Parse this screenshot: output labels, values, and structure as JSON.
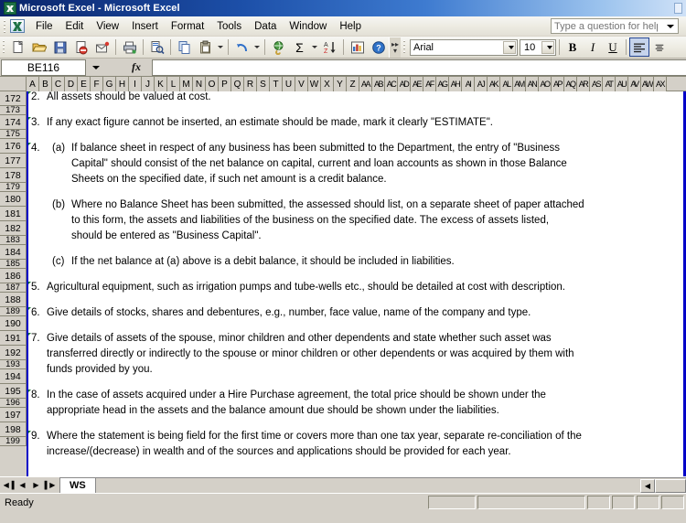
{
  "window": {
    "title": "Microsoft Excel - Microsoft Excel",
    "app_icon": "excel-icon"
  },
  "menubar": {
    "items": [
      "File",
      "Edit",
      "View",
      "Insert",
      "Format",
      "Tools",
      "Data",
      "Window",
      "Help"
    ],
    "ask_a_question": {
      "value": "",
      "placeholder": "Type a question for help"
    }
  },
  "toolbar": {
    "buttons": [
      {
        "name": "new-document-button",
        "glyph": "❐",
        "title": "New"
      },
      {
        "name": "open-folder-button",
        "glyph": "📂",
        "title": "Open"
      },
      {
        "name": "save-button",
        "glyph": "💾",
        "title": "Save"
      },
      {
        "name": "permission-button",
        "glyph": "⛔",
        "title": "Permission"
      },
      {
        "name": "email-button",
        "glyph": "✉",
        "title": "E-mail"
      },
      {
        "name": "print-button",
        "glyph": "⎙",
        "title": "Print"
      },
      {
        "name": "print-preview-button",
        "glyph": "🔍",
        "title": "Print Preview"
      },
      {
        "name": "copy-button",
        "glyph": "⧉",
        "title": "Copy"
      },
      {
        "name": "paste-button",
        "glyph": "📋",
        "title": "Paste"
      },
      {
        "name": "undo-button",
        "glyph": "↶",
        "title": "Undo"
      },
      {
        "name": "hyperlink-button",
        "glyph": "🌐",
        "title": "Insert Hyperlink"
      },
      {
        "name": "autosum-button",
        "glyph": "Σ",
        "title": "AutoSum"
      },
      {
        "name": "sort-ascending-button",
        "glyph": "↓",
        "title": "Sort Ascending"
      },
      {
        "name": "chart-wizard-button",
        "glyph": "📊",
        "title": "Chart Wizard"
      },
      {
        "name": "help-button",
        "glyph": "?",
        "title": "Microsoft Excel Help"
      }
    ],
    "font_name": "Arial",
    "font_size": "10",
    "bold_label": "B",
    "italic_label": "I",
    "underline_label": "U",
    "align_left_label": "≡",
    "align_center_label": "≡"
  },
  "formula_bar": {
    "name_box": "BE116",
    "fx_label": "fx",
    "formula_value": ""
  },
  "grid": {
    "columns": [
      "A",
      "B",
      "C",
      "D",
      "E",
      "F",
      "G",
      "H",
      "I",
      "J",
      "K",
      "L",
      "M",
      "N",
      "O",
      "P",
      "Q",
      "R",
      "S",
      "T",
      "U",
      "V",
      "W",
      "X",
      "Y",
      "Z",
      "AA",
      "AB",
      "AC",
      "AD",
      "AE",
      "AF",
      "AG",
      "AH",
      "AI",
      "AJ",
      "AK",
      "AL",
      "AM",
      "AN",
      "AO",
      "AP",
      "AQ",
      "AR",
      "AS",
      "AT",
      "AU",
      "AV",
      "AW",
      "AX"
    ],
    "rows": [
      "172",
      "173",
      "174",
      "175",
      "176",
      "177",
      "178",
      "179",
      "180",
      "181",
      "182",
      "183",
      "184",
      "185",
      "186",
      "187",
      "188",
      "189",
      "190",
      "191",
      "192",
      "193",
      "194",
      "195",
      "196",
      "197",
      "198",
      "199"
    ],
    "content": [
      {
        "row": "172",
        "number": "2.",
        "letter": "",
        "text": "All assets should be valued at cost."
      },
      {
        "row": "174",
        "number": "3.",
        "letter": "",
        "text": "If any exact figure cannot be inserted, an estimate should be made, mark it clearly \"ESTIMATE\"."
      },
      {
        "row": "176",
        "number": "4.",
        "letter": "(a)",
        "text": "If balance sheet in respect of any business has been submitted to the Department, the entry of \"Business"
      },
      {
        "row": "177",
        "number": "",
        "letter": "",
        "text": "Capital\" should consist of the net balance on capital, current and loan accounts as shown in those Balance"
      },
      {
        "row": "178",
        "number": "",
        "letter": "",
        "text": "Sheets on the specified date, if such net amount is a credit balance."
      },
      {
        "row": "180",
        "number": "",
        "letter": "(b)",
        "text": "Where no Balance Sheet has been submitted, the assessed should list, on a separate sheet of paper attached"
      },
      {
        "row": "181",
        "number": "",
        "letter": "",
        "text": "to this form, the assets and liabilities of the business on the specified date. The excess of assets listed,"
      },
      {
        "row": "182",
        "number": "",
        "letter": "",
        "text": "should be entered as \"Business Capital\"."
      },
      {
        "row": "184",
        "number": "",
        "letter": "(c)",
        "text": "If the net balance at (a) above is a debit balance, it should be included in liabilities."
      },
      {
        "row": "186",
        "number": "5.",
        "letter": "",
        "text": "Agricultural equipment, such as irrigation pumps and tube-wells etc., should be detailed at cost with description."
      },
      {
        "row": "188",
        "number": "6.",
        "letter": "",
        "text": "Give details of stocks, shares and debentures, e.g., number, face value, name of the company and type."
      },
      {
        "row": "190",
        "number": "7.",
        "letter": "",
        "text": "Give details of assets of the spouse, minor children and other dependents and state whether such asset was"
      },
      {
        "row": "191",
        "number": "",
        "letter": "",
        "text": "transferred directly or indirectly to the spouse or minor children or other dependents or was acquired by them with"
      },
      {
        "row": "192",
        "number": "",
        "letter": "",
        "text": "funds provided by you."
      },
      {
        "row": "194",
        "number": "8.",
        "letter": "",
        "text": "In the case of assets acquired under a Hire Purchase agreement, the total price should be shown under the"
      },
      {
        "row": "195",
        "number": "",
        "letter": "",
        "text": "appropriate head in the assets and the balance amount due should be shown under the liabilities."
      },
      {
        "row": "197",
        "number": "9.",
        "letter": "",
        "text": "Where the statement is being field for the first time or covers more than one tax year, separate re-conciliation of the"
      },
      {
        "row": "198",
        "number": "",
        "letter": "",
        "text": "increase/(decrease) in wealth and of the sources and applications should be provided for each year."
      }
    ]
  },
  "sheet_tabs": {
    "first_label": "◀▐",
    "prev_label": "◀",
    "next_label": "▶",
    "last_label": "▌▶",
    "tabs": [
      {
        "label": "WS",
        "active": true
      }
    ]
  },
  "status_bar": {
    "text": "Ready"
  },
  "colors": {
    "titlebar_start": "#0a246a",
    "split_line": "#0000c8",
    "comment_marker": "#1a7a33",
    "chrome": "#d4d0c8"
  }
}
